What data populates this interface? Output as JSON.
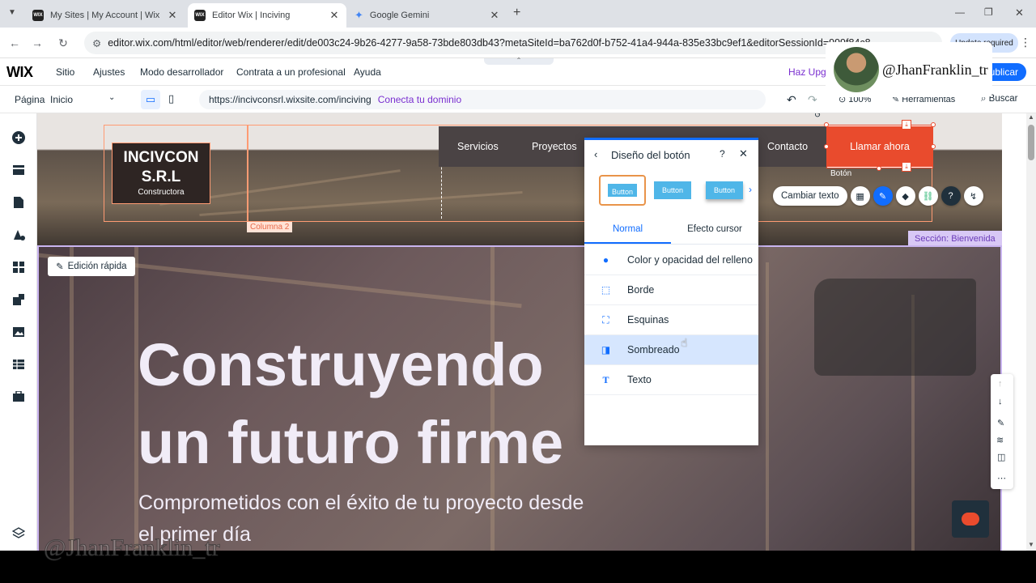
{
  "browser": {
    "tabs": [
      {
        "favicon": "WIX",
        "title": "My Sites | My Account | Wix.com"
      },
      {
        "favicon": "WIX",
        "title": "Editor Wix | Inciving"
      },
      {
        "favicon": "gemini-icon",
        "title": "Google Gemini"
      }
    ],
    "url": "editor.wix.com/html/editor/web/renderer/edit/de003c24-9b26-4277-9a58-73bde803db43?metaSiteId=ba762d0f-b752-41a4-944a-835e33bc9ef1&editorSessionId=999f84c8",
    "profile_badge": "Update required"
  },
  "wix": {
    "logo": "WIX",
    "menu": [
      "Sitio",
      "Ajustes",
      "Modo desarrollador",
      "Contrata a un profesional",
      "Ayuda"
    ],
    "upgrade": "Haz Upgr",
    "publish": "ublicar",
    "page_label": "Página",
    "page_value": "Inicio",
    "site_url": "https://incivconsrl.wixsite.com/inciving",
    "connect_domain": "Conecta tu dominio",
    "zoom": "100%",
    "tools": "Herramientas",
    "search": "Buscar"
  },
  "watermark": {
    "handle": "@JhanFranklin_tr",
    "bottom": "@JhanFranklin_tr"
  },
  "site": {
    "logo_line1": "INCIVCON",
    "logo_line2": "S.R.L",
    "logo_line3": "Constructora",
    "nav": [
      "Servicios",
      "Proyectos",
      "Contacto"
    ],
    "cta": "Llamar ahora",
    "element_label": "Botón",
    "column_label": "Columna 2",
    "section_label": "Sección: Bienvenida",
    "quick_edit": "Edición rápida",
    "hero_line1": "Construyendo",
    "hero_line2": "un futuro firme",
    "hero_sub1": "Comprometidos con el éxito de tu proyecto desde",
    "hero_sub2": "el primer día",
    "change_text": "Cambiar texto"
  },
  "panel": {
    "title": "Diseño del botón",
    "help": "?",
    "presets": [
      "Button",
      "Button",
      "Button"
    ],
    "tabs": [
      "Normal",
      "Efecto cursor"
    ],
    "options": [
      {
        "label": "Color y opacidad del relleno",
        "icon": "drop-icon"
      },
      {
        "label": "Borde",
        "icon": "border-icon"
      },
      {
        "label": "Esquinas",
        "icon": "corners-icon"
      },
      {
        "label": "Sombreado",
        "icon": "shadow-icon",
        "selected": true
      },
      {
        "label": "Texto",
        "icon": "text-icon"
      }
    ]
  },
  "colors": {
    "accent": "#116dff",
    "cta": "#e94b2d",
    "selected_row": "#d6e6fe",
    "section_tag": "#d8c8f5"
  }
}
